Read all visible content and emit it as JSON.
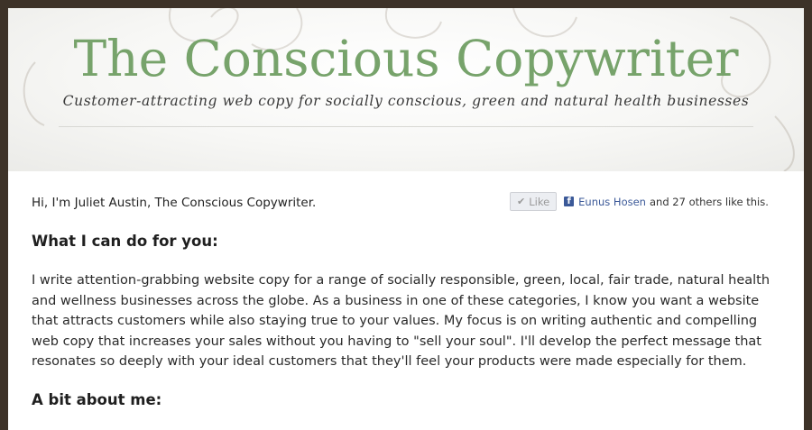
{
  "header": {
    "title": "The Conscious Copywriter",
    "tagline": "Customer-attracting web copy for socially conscious, green and natural health businesses"
  },
  "intro": "Hi, I'm Juliet Austin, The Conscious Copywriter.",
  "facebook": {
    "like_label": "Like",
    "friend_name": "Eunus Hosen",
    "social_text": "and 27 others like this.",
    "brand_color": "#3b5998"
  },
  "sections": [
    {
      "heading": "What I can do for you:",
      "body": "I write attention-grabbing website copy for a range of socially responsible, green, local, fair trade, natural health and wellness businesses across the globe. As a business in one of these categories, I know you want a website that attracts customers while also staying true to your values. My focus is on writing authentic and compelling web copy that increases your sales without you having to \"sell your soul\". I'll develop the perfect message that resonates so deeply with your ideal customers that they'll feel your products were made especially for them."
    },
    {
      "heading": "A bit about me:"
    }
  ],
  "colors": {
    "frame": "#3d3228",
    "title_green": "#77a36b"
  }
}
